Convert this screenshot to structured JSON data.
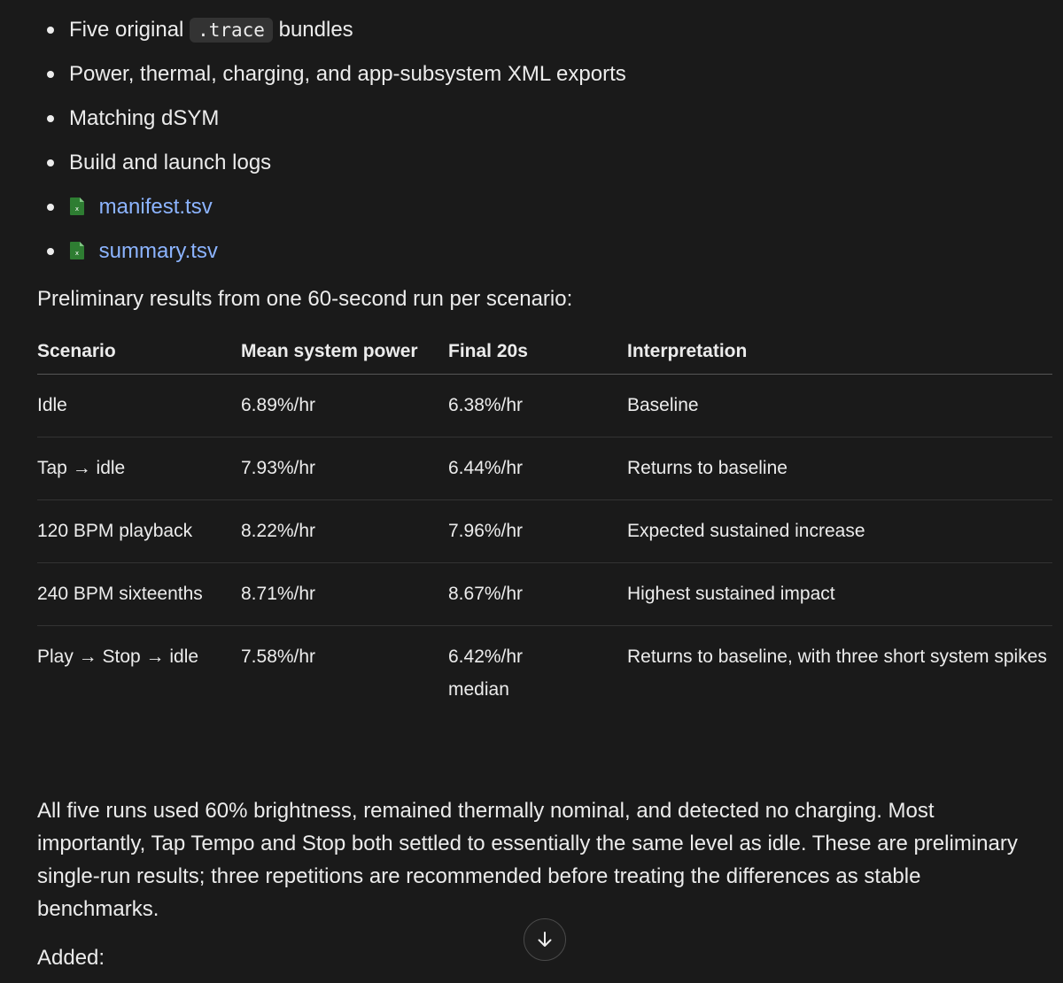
{
  "bullets": [
    {
      "prefix": "Five original",
      "code": ".trace",
      "suffix": "bundles"
    },
    {
      "text": "Power, thermal, charging, and app-subsystem XML exports"
    },
    {
      "text": "Matching dSYM"
    },
    {
      "text": "Build and launch logs"
    },
    {
      "file": "manifest.tsv",
      "icon": "spreadsheet-file-icon"
    },
    {
      "file": "summary.tsv",
      "icon": "spreadsheet-file-icon"
    }
  ],
  "intro": "Preliminary results from one 60-second run per scenario:",
  "table": {
    "headers": [
      "Scenario",
      "Mean system power",
      "Final 20s",
      "Interpretation"
    ],
    "rows": [
      [
        "Idle",
        "6.89%/hr",
        "6.38%/hr",
        "Baseline"
      ],
      [
        "Tap → idle",
        "7.93%/hr",
        "6.44%/hr",
        "Returns to baseline"
      ],
      [
        "120 BPM playback",
        "8.22%/hr",
        "7.96%/hr",
        "Expected sustained increase"
      ],
      [
        "240 BPM sixteenths",
        "8.71%/hr",
        "8.67%/hr",
        "Highest sustained impact"
      ],
      [
        "Play → Stop → idle",
        "7.58%/hr",
        "6.42%/hr median",
        "Returns to baseline, with three short system spikes"
      ]
    ]
  },
  "summary": "All five runs used 60% brightness, remained thermally nominal, and detected no charging. Most importantly, Tap Tempo and Stop both settled to essentially the same level as idle. These are preliminary single-run results; three repetitions are recommended before treating the differences as stable benchmarks.",
  "added": "Added:",
  "scroll_button": {
    "icon": "arrow-down-icon"
  },
  "colors": {
    "background": "#1a1a1a",
    "text": "#ececec",
    "link": "#8cb4ff",
    "code_bg": "#333333",
    "file_icon": "#2e7d32"
  }
}
